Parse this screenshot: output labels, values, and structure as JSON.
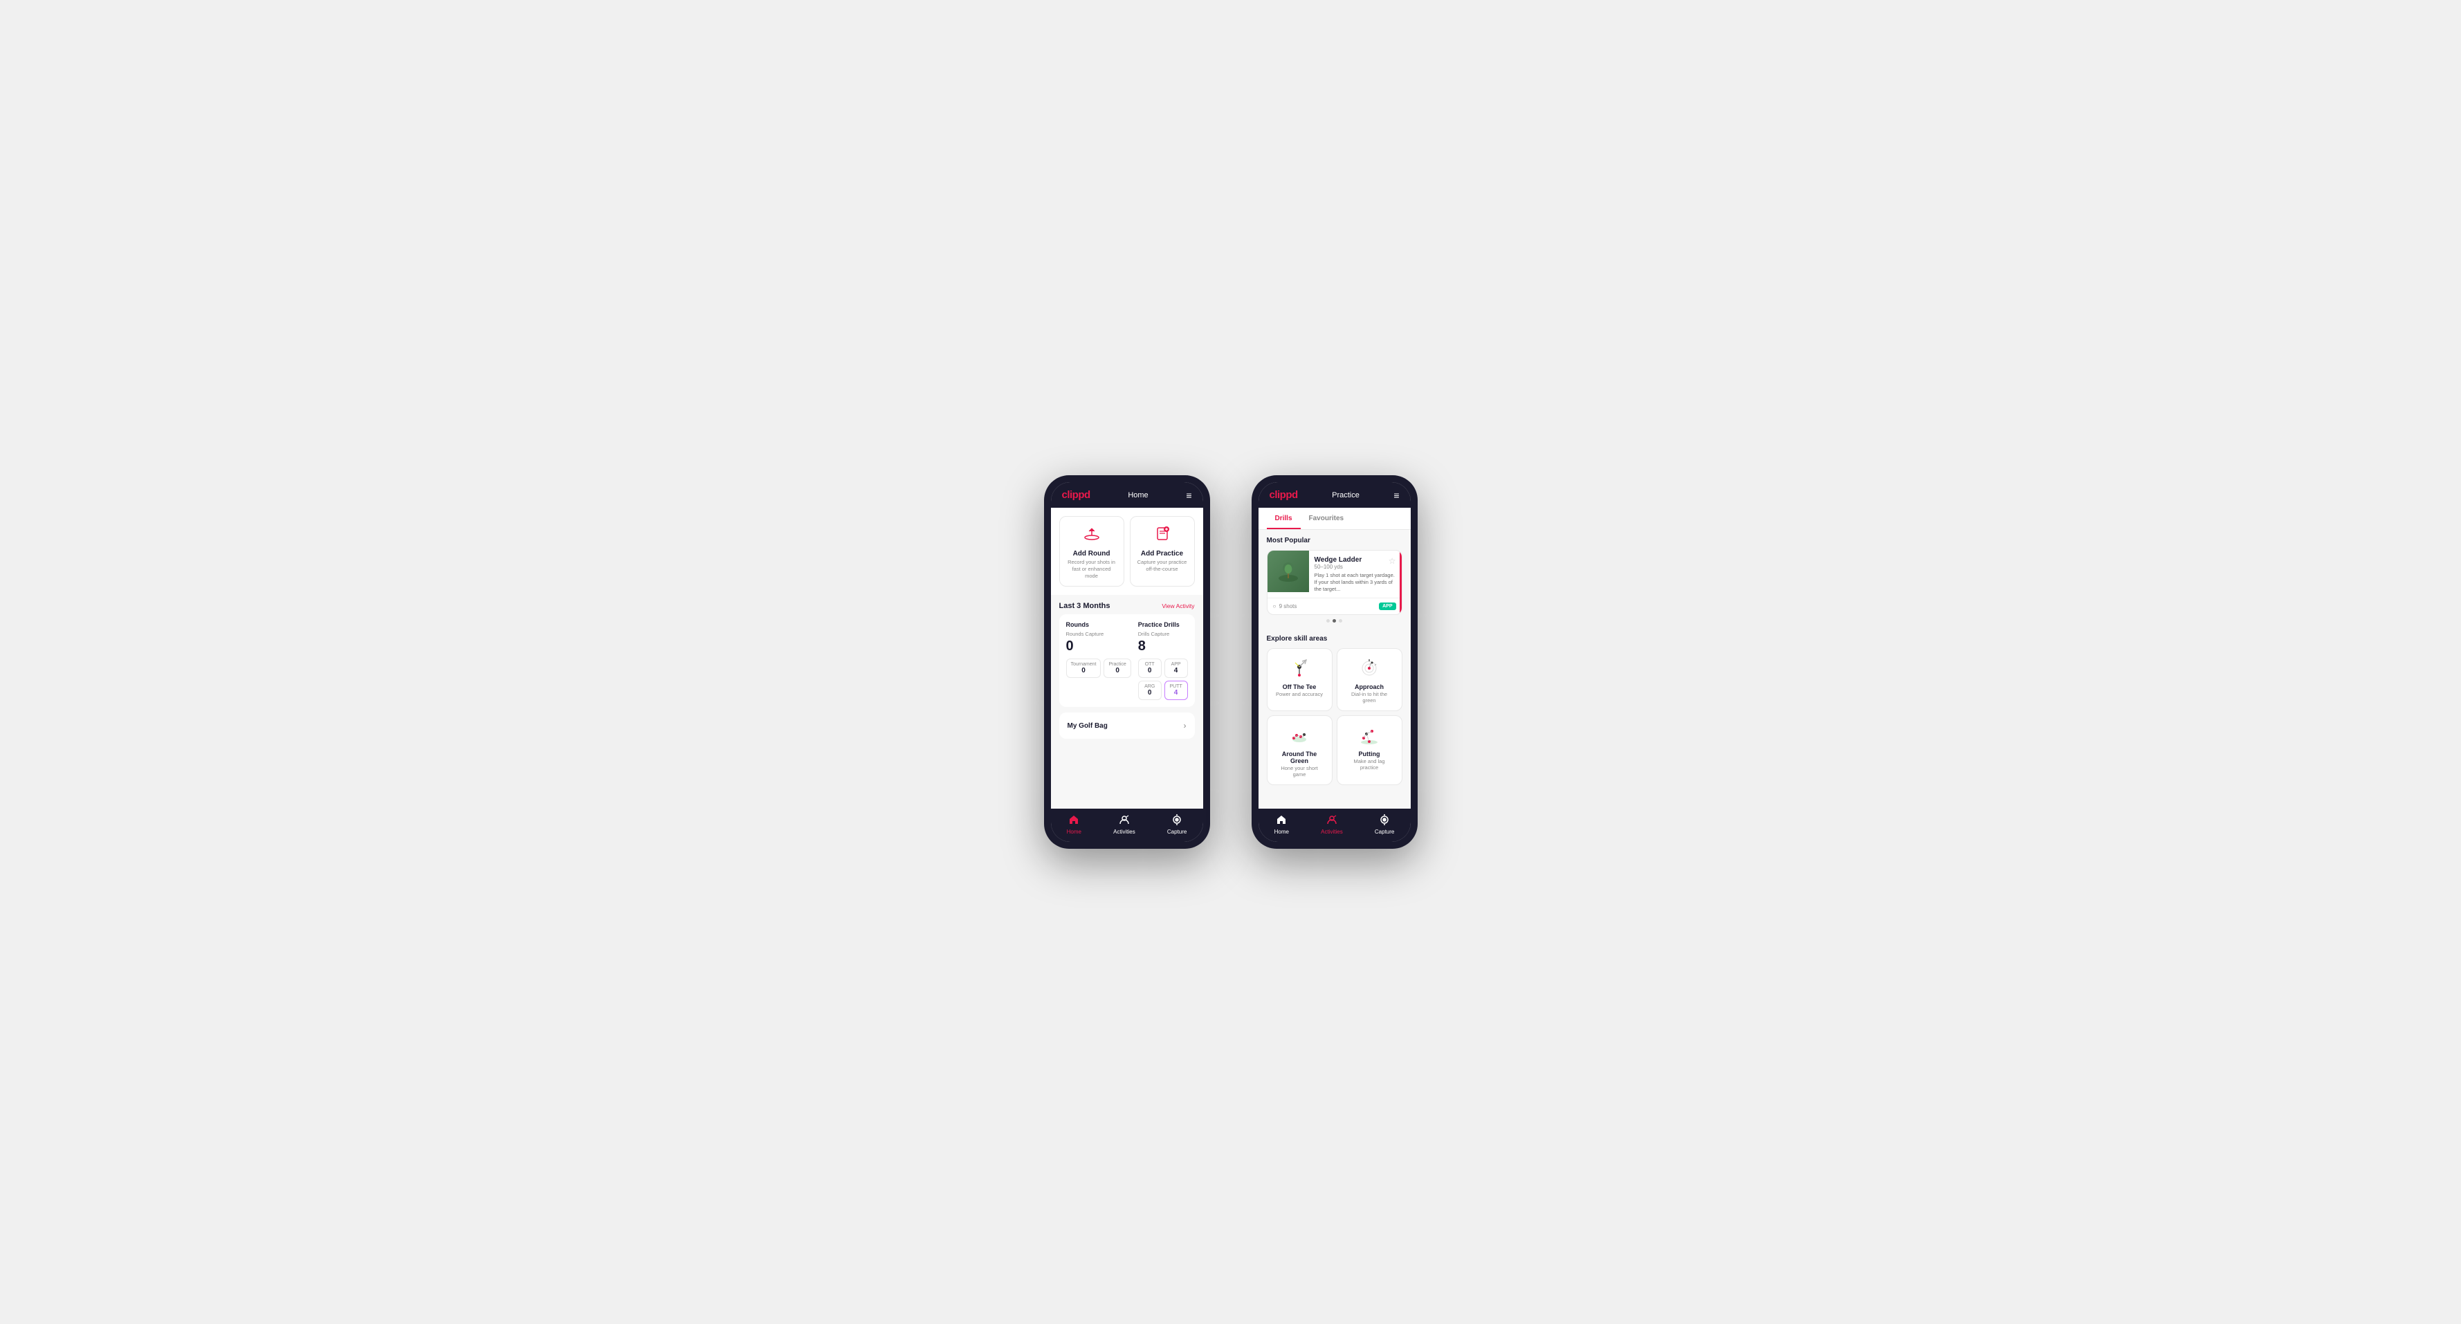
{
  "phone1": {
    "header": {
      "logo": "clippd",
      "title": "Home",
      "menu_icon": "≡"
    },
    "quick_actions": [
      {
        "id": "add-round",
        "icon": "⛳",
        "title": "Add Round",
        "desc": "Record your shots in fast or enhanced mode"
      },
      {
        "id": "add-practice",
        "icon": "📋",
        "title": "Add Practice",
        "desc": "Capture your practice off-the-course"
      }
    ],
    "activity_section": {
      "title": "Last 3 Months",
      "link": "View Activity"
    },
    "rounds": {
      "title": "Rounds",
      "capture_label": "Rounds Capture",
      "capture_value": "0",
      "tournament_label": "Tournament",
      "tournament_value": "0",
      "practice_label": "Practice",
      "practice_value": "0"
    },
    "practice_drills": {
      "title": "Practice Drills",
      "capture_label": "Drills Capture",
      "capture_value": "8",
      "ott_label": "OTT",
      "ott_value": "0",
      "app_label": "APP",
      "app_value": "4",
      "arg_label": "ARG",
      "arg_value": "0",
      "putt_label": "PUTT",
      "putt_value": "4"
    },
    "golf_bag": {
      "label": "My Golf Bag"
    },
    "nav": {
      "home": "Home",
      "activities": "Activities",
      "capture": "Capture"
    }
  },
  "phone2": {
    "header": {
      "logo": "clippd",
      "title": "Practice",
      "menu_icon": "≡"
    },
    "tabs": [
      {
        "id": "drills",
        "label": "Drills",
        "active": true
      },
      {
        "id": "favourites",
        "label": "Favourites",
        "active": false
      }
    ],
    "most_popular": {
      "title": "Most Popular",
      "drill": {
        "name": "Wedge Ladder",
        "yardage": "50–100 yds",
        "desc": "Play 1 shot at each target yardage. If your shot lands within 3 yards of the target...",
        "shots": "9 shots",
        "badge": "APP"
      }
    },
    "explore": {
      "title": "Explore skill areas",
      "skills": [
        {
          "id": "off-the-tee",
          "name": "Off The Tee",
          "desc": "Power and accuracy",
          "icon": "tee"
        },
        {
          "id": "approach",
          "name": "Approach",
          "desc": "Dial-in to hit the green",
          "icon": "approach"
        },
        {
          "id": "around-the-green",
          "name": "Around The Green",
          "desc": "Hone your short game",
          "icon": "arg"
        },
        {
          "id": "putting",
          "name": "Putting",
          "desc": "Make and lag practice",
          "icon": "putt"
        }
      ]
    },
    "nav": {
      "home": "Home",
      "activities": "Activities",
      "capture": "Capture"
    }
  }
}
